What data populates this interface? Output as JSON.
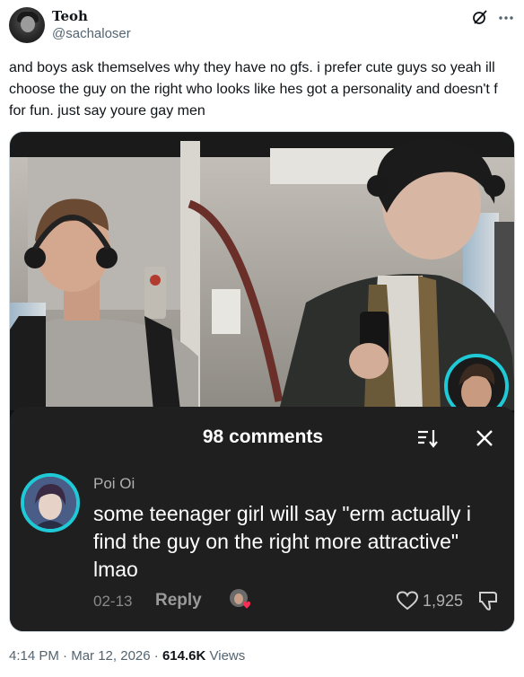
{
  "tweet": {
    "author_name": "Teoh",
    "author_handle": "@sachaloser",
    "text": "and boys ask themselves why they have no gfs. i prefer cute guys so yeah ill choose the guy on the right who looks like hes got a personality and doesn't f for fun. just say youre gay men",
    "time": "4:14 PM",
    "separator": "·",
    "date": "Mar 12, 2026",
    "views_count": "614.6K",
    "views_label": "Views"
  },
  "comments_panel": {
    "title": "98 comments",
    "comment": {
      "username": "Poi Oi",
      "text": "some teenager girl will say \"erm actually i find the guy on the right more attractive\" lmao",
      "date": "02-13",
      "reply_label": "Reply",
      "likes": "1,925"
    }
  },
  "icons": {
    "header": [
      "grok-slash-icon",
      "more-icon"
    ],
    "panel": [
      "sort-icon",
      "close-icon",
      "heart-icon",
      "dislike-icon"
    ]
  },
  "colors": {
    "text_primary": "#0f1419",
    "text_secondary": "#536471",
    "panel_bg": "#1f1f1f",
    "avatar_ring": "#20c9d6"
  }
}
